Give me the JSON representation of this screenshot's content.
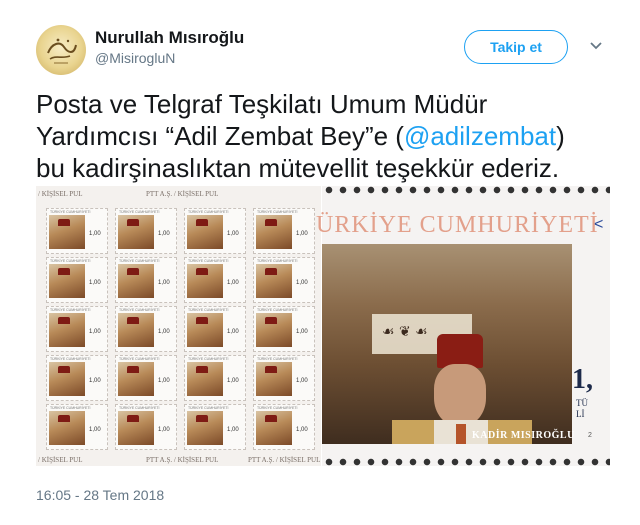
{
  "author": {
    "name": "Nurullah Mısıroğlu",
    "handle": "@MisirogluN"
  },
  "actions": {
    "follow_label": "Takip et",
    "menu_icon": "chevron-down-icon"
  },
  "tweet": {
    "text_part1": "Posta ve Telgraf Teşkilatı Umum Müdür",
    "text_part2": "Yardımcısı “Adil Zembat Bey”e (",
    "mention": "@adilzembat",
    "text_part3": ")",
    "text_part4": "bu kadirşinaslıktan mütevellit teşekkür ederiz."
  },
  "media": {
    "sheet_label_top_left": "/ KİŞİSEL PUL",
    "sheet_label_top_mid": "PTT A.Ş. / KİŞİSEL PUL",
    "sheet_label_bottom_left": "/ KİŞİSEL PUL",
    "sheet_label_bottom_mid": "PTT A.Ş. / KİŞİSEL PUL",
    "sheet_label_bottom_right": "PTT A.Ş. / KİŞİSEL PUL",
    "stamp_header": "TÜRKİYE CUMHURİYETİ",
    "stamp_value": "1,00",
    "big_title": "ÜRKİYE CUMHURİYETİ",
    "big_caption": "KADİR MISIROĞLU",
    "big_value": "1,",
    "big_side_line1": "TÜ",
    "big_side_line2": "Lİ",
    "big_side_year": "2"
  },
  "timestamp": "16:05 - 28 Tem 2018",
  "colors": {
    "accent": "#1da1f2",
    "text": "#14171a",
    "muted": "#657786"
  }
}
